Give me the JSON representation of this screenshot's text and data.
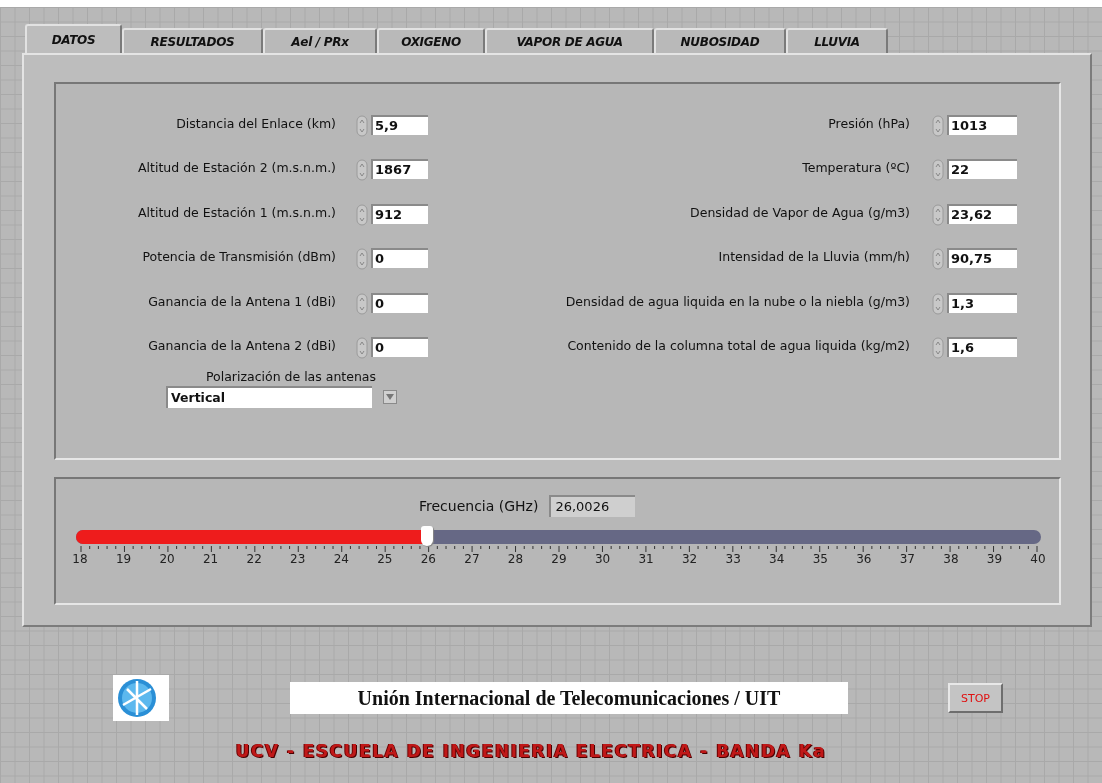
{
  "tabs": [
    {
      "label": "DATOS",
      "selected": true
    },
    {
      "label": "RESULTADOS",
      "selected": false
    },
    {
      "label": "Ael / PRx",
      "selected": false
    },
    {
      "label": "OXIGENO",
      "selected": false
    },
    {
      "label": "VAPOR DE AGUA",
      "selected": false
    },
    {
      "label": "NUBOSIDAD",
      "selected": false
    },
    {
      "label": "LLUVIA",
      "selected": false
    }
  ],
  "left_fields": [
    {
      "label": "Distancia del Enlace (km)",
      "value": "5,9"
    },
    {
      "label": "Altitud de Estación 2 (m.s.n.m.)",
      "value": "1867"
    },
    {
      "label": "Altitud de Estación 1 (m.s.n.m.)",
      "value": "912"
    },
    {
      "label": "Potencia de Transmisión (dBm)",
      "value": "0"
    },
    {
      "label": "Ganancia de la Antena 1 (dBi)",
      "value": "0"
    },
    {
      "label": "Ganancia de la Antena 2 (dBi)",
      "value": "0"
    }
  ],
  "right_fields": [
    {
      "label": "Presión (hPa)",
      "value": "1013"
    },
    {
      "label": "Temperatura (ºC)",
      "value": "22"
    },
    {
      "label": "Densidad de Vapor de Agua (g/m3)",
      "value": "23,62"
    },
    {
      "label": "Intensidad de la Lluvia (mm/h)",
      "value": "90,75"
    },
    {
      "label": "Densidad de agua liquida en la nube o la niebla (g/m3)",
      "value": "1,3"
    },
    {
      "label": "Contenido de la columna  total de agua liquida (kg/m2)",
      "value": "1,6"
    }
  ],
  "polarization": {
    "label": "Polarización de las antenas",
    "value": "Vertical"
  },
  "frequency": {
    "label": "Frecuencia (GHz)",
    "value": "26,0026",
    "level": 0.3637,
    "ticks": [
      "18",
      "19",
      "20",
      "21",
      "22",
      "23",
      "24",
      "25",
      "26",
      "27",
      "28",
      "29",
      "30",
      "31",
      "32",
      "33",
      "34",
      "35",
      "36",
      "37",
      "38",
      "39",
      "40"
    ]
  },
  "title": "Unión Internacional de Telecomunicaciones /  UIT",
  "stop_button": "STOP",
  "footer": "UCV - ESCUELA DE INGENIERIA ELECTRICA - BANDA Ka"
}
